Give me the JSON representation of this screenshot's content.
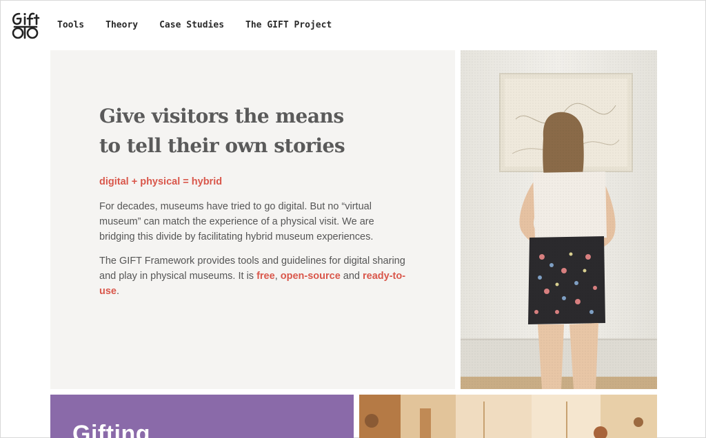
{
  "header": {
    "logo_text": "GIFT",
    "nav": [
      "Tools",
      "Theory",
      "Case Studies",
      "The GIFT Project"
    ]
  },
  "hero": {
    "title_line1": "Give visitors the means",
    "title_line2": "to tell their own stories",
    "equation": "digital + physical = hybrid",
    "paragraph1": "For decades, museums have tried to go digital. But no “virtual museum” can match the experience of a physical visit. We are bridging this divide by facilitating hybrid museum experiences.",
    "paragraph2_prefix": "The GIFT Framework provides tools and guidelines for digital sharing and play in physical museums. It is ",
    "link_free": "free",
    "sep_comma": ", ",
    "link_open_source": "open-source",
    "sep_and": " and ",
    "link_ready": "ready-to-use",
    "paragraph2_suffix": "."
  },
  "cards": {
    "gifting_title": "Gifting"
  },
  "colors": {
    "accent": "#d9574b",
    "card_bg": "#f5f4f2",
    "gifting_bg": "#8a6aa9",
    "title_text": "#5a5a5a"
  }
}
